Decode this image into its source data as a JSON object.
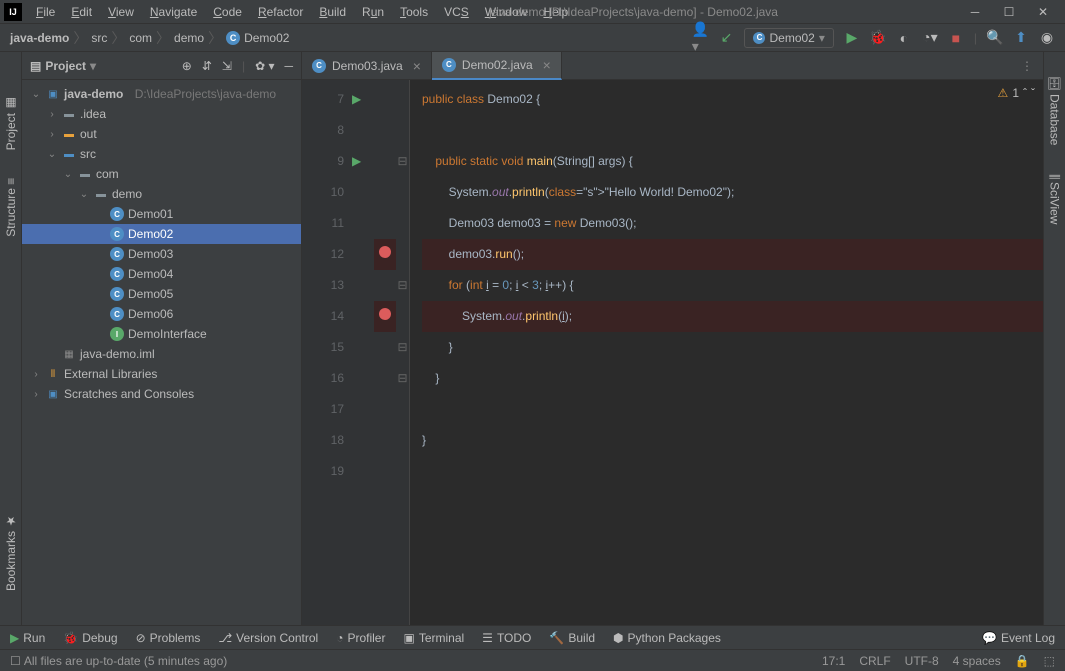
{
  "titlebar": "java-demo [D:\\IdeaProjects\\java-demo] - Demo02.java",
  "menus": [
    "File",
    "Edit",
    "View",
    "Navigate",
    "Code",
    "Refactor",
    "Build",
    "Run",
    "Tools",
    "VCS",
    "Window",
    "Help"
  ],
  "breadcrumb": {
    "project": "java-demo",
    "p1": "src",
    "p2": "com",
    "p3": "demo",
    "cls": "Demo02"
  },
  "run_config": "Demo02",
  "sidebar": {
    "title": "Project",
    "root": {
      "name": "java-demo",
      "path": "D:\\IdeaProjects\\java-demo"
    },
    "idea": ".idea",
    "out": "out",
    "src": "src",
    "com": "com",
    "demo": "demo",
    "files": [
      "Demo01",
      "Demo02",
      "Demo03",
      "Demo04",
      "Demo05",
      "Demo06",
      "DemoInterface"
    ],
    "iml": "java-demo.iml",
    "ext": "External Libraries",
    "scratch": "Scratches and Consoles"
  },
  "left_tabs": {
    "project": "Project",
    "structure": "Structure",
    "bookmarks": "Bookmarks"
  },
  "right_tabs": {
    "database": "Database",
    "sciview": "SciView"
  },
  "tabs": [
    {
      "name": "Demo03.java",
      "active": false
    },
    {
      "name": "Demo02.java",
      "active": true
    }
  ],
  "warn_count": "1",
  "code_lines": {
    "7": "public class Demo02 {",
    "8": "",
    "9": "    public static void main(String[] args) {",
    "10": "        System.out.println(\"Hello World! Demo02\");",
    "11": "        Demo03 demo03 = new Demo03();",
    "12": "        demo03.run();",
    "13": "        for (int i = 0; i < 3; i++) {",
    "14": "            System.out.println(i);",
    "15": "        }",
    "16": "    }",
    "17": "",
    "18": "}",
    "19": ""
  },
  "run_markers": {
    "7": true,
    "9": true
  },
  "breakpoints": {
    "12": true,
    "14": true
  },
  "fold_markers": {
    "9": "⊟",
    "13": "⊟",
    "15": "⊟",
    "16": "⊟"
  },
  "bottom": {
    "run": "Run",
    "debug": "Debug",
    "problems": "Problems",
    "vcs": "Version Control",
    "profiler": "Profiler",
    "terminal": "Terminal",
    "todo": "TODO",
    "build": "Build",
    "python": "Python Packages",
    "event": "Event Log"
  },
  "status": {
    "msg": "All files are up-to-date (5 minutes ago)",
    "pos": "17:1",
    "sep": "CRLF",
    "enc": "UTF-8",
    "indent": "4 spaces"
  }
}
